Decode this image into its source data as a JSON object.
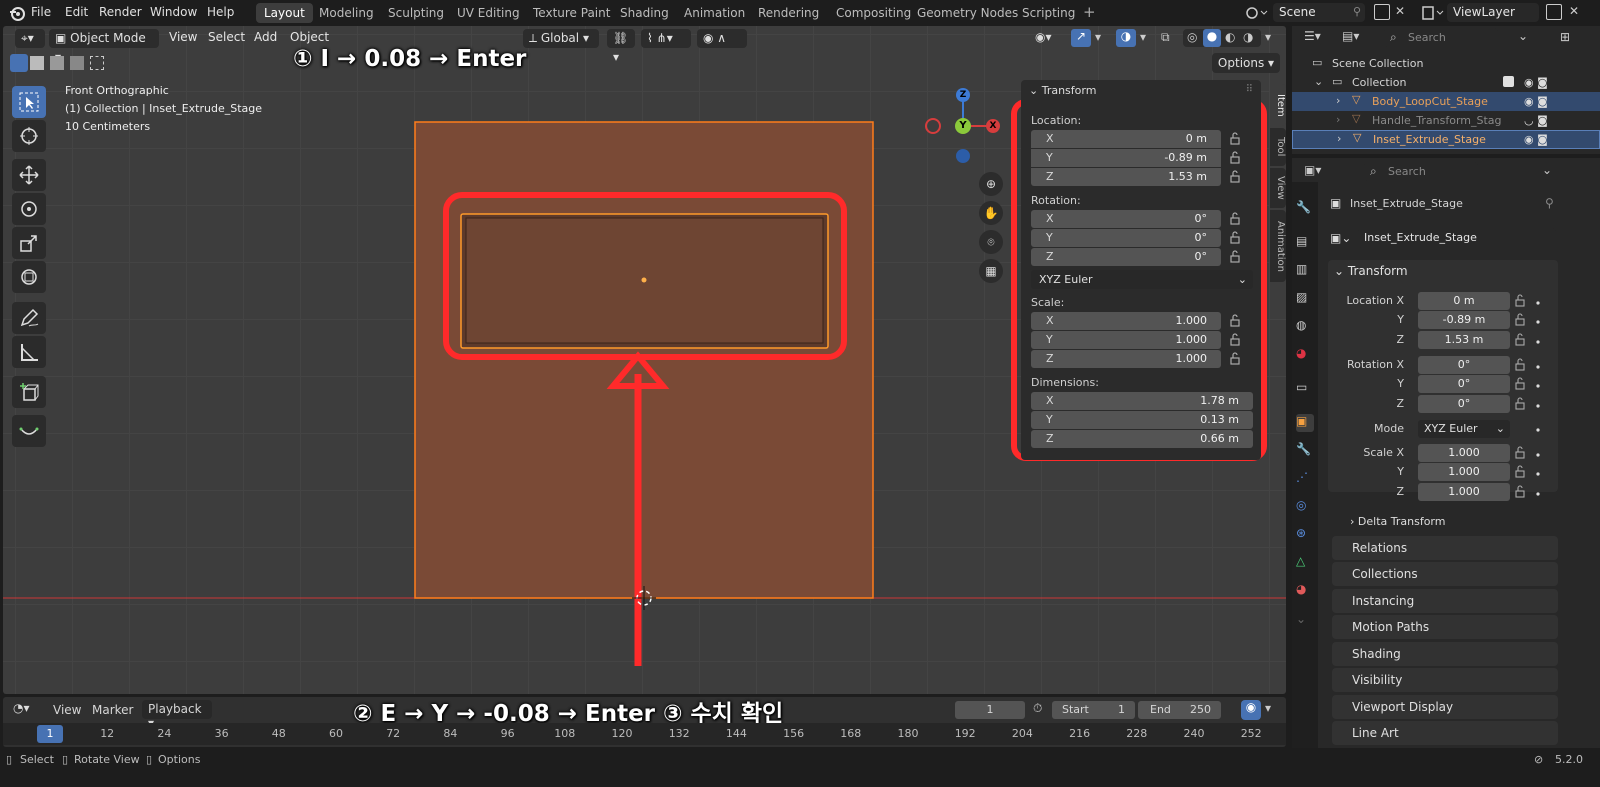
{
  "menubar": {
    "items": [
      "File",
      "Edit",
      "Render",
      "Window",
      "Help"
    ],
    "workspaces": [
      "Layout",
      "Modeling",
      "Sculpting",
      "UV Editing",
      "Texture Paint",
      "Shading",
      "Animation",
      "Rendering",
      "Compositing",
      "Geometry Nodes",
      "Scripting"
    ],
    "active_workspace": "Layout",
    "scene": "Scene",
    "view_layer": "ViewLayer"
  },
  "viewport": {
    "mode": "Object Mode",
    "menus": [
      "View",
      "Select",
      "Add",
      "Object"
    ],
    "orientation": "Global",
    "options_label": "Options",
    "view_name": "Front Orthographic",
    "collection_info": "(1) Collection | Inset_Extrude_Stage",
    "scale_info": "10 Centimeters",
    "gizmo": {
      "z": "Z",
      "y": "Y",
      "x": "X"
    }
  },
  "annotations": {
    "step1": "① I → 0.08 → Enter",
    "step2": "② E → Y → -0.08 → Enter  ③ 수치 확인"
  },
  "npanel": {
    "header": "Transform",
    "location_label": "Location:",
    "location": [
      {
        "k": "X",
        "v": "0 m"
      },
      {
        "k": "Y",
        "v": "-0.89 m"
      },
      {
        "k": "Z",
        "v": "1.53 m"
      }
    ],
    "rotation_label": "Rotation:",
    "rotation": [
      {
        "k": "X",
        "v": "0°"
      },
      {
        "k": "Y",
        "v": "0°"
      },
      {
        "k": "Z",
        "v": "0°"
      }
    ],
    "rotation_mode": "XYZ Euler",
    "scale_label": "Scale:",
    "scale": [
      {
        "k": "X",
        "v": "1.000"
      },
      {
        "k": "Y",
        "v": "1.000"
      },
      {
        "k": "Z",
        "v": "1.000"
      }
    ],
    "dimensions_label": "Dimensions:",
    "dimensions": [
      {
        "k": "X",
        "v": "1.78 m"
      },
      {
        "k": "Y",
        "v": "0.13 m"
      },
      {
        "k": "Z",
        "v": "0.66 m"
      }
    ],
    "tabs": [
      "Item",
      "Tool",
      "View",
      "Animation"
    ]
  },
  "timeline": {
    "menus": [
      "View",
      "Marker",
      "Playback"
    ],
    "current_frame": "1",
    "start_label": "Start",
    "start": "1",
    "end_label": "End",
    "end": "250",
    "ticks": [
      "1",
      "12",
      "24",
      "36",
      "48",
      "60",
      "72",
      "84",
      "96",
      "108",
      "120",
      "132",
      "144",
      "156",
      "168",
      "180",
      "192",
      "204",
      "216",
      "228",
      "240",
      "252"
    ]
  },
  "outliner": {
    "search_placeholder": "Search",
    "scene_collection": "Scene Collection",
    "collection": "Collection",
    "objects": [
      "Body_LoopCut_Stage",
      "Handle_Transform_Stag",
      "Inset_Extrude_Stage"
    ]
  },
  "properties": {
    "search_placeholder": "Search",
    "object_name": "Inset_Extrude_Stage",
    "object_field": "Inset_Extrude_Stage",
    "transform_header": "Transform",
    "location_x_label": "Location X",
    "loc": [
      "0 m",
      "-0.89 m",
      "1.53 m"
    ],
    "rotation_x_label": "Rotation X",
    "rot": [
      "0°",
      "0°",
      "0°"
    ],
    "mode_label": "Mode",
    "mode": "XYZ Euler",
    "scale_x_label": "Scale X",
    "scale": [
      "1.000",
      "1.000",
      "1.000"
    ],
    "y_label": "Y",
    "z_label": "Z",
    "delta_transform": "Delta Transform",
    "sections": [
      "Relations",
      "Collections",
      "Instancing",
      "Motion Paths",
      "Shading",
      "Visibility",
      "Viewport Display",
      "Line Art"
    ]
  },
  "statusbar": {
    "select": "Select",
    "rotate_view": "Rotate View",
    "options": "Options",
    "version": "5.2.0"
  },
  "colors": {
    "accent": "#4772b3",
    "highlight": "#ff2a2a",
    "selected_orange": "#ff9a2a",
    "object_fill": "#7a4a36"
  }
}
